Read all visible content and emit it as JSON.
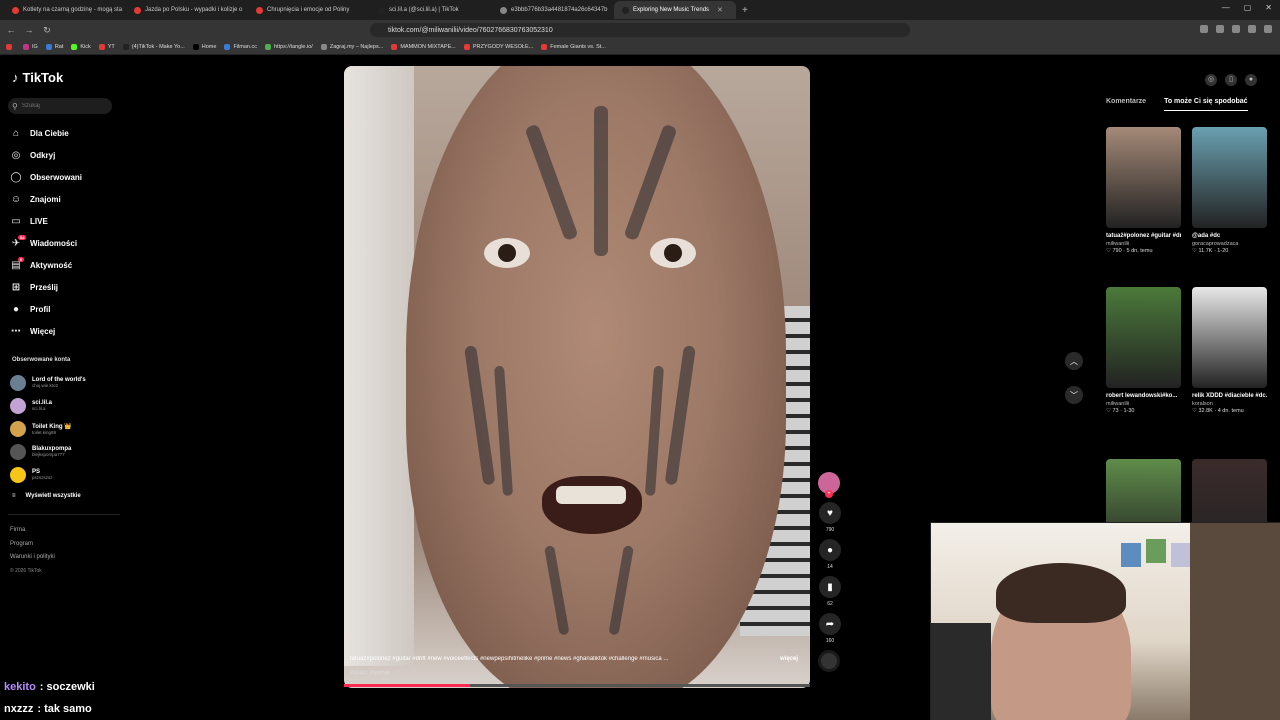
{
  "browser": {
    "tabs": [
      {
        "label": "Kotlety na czarną godzinę - mogą sta",
        "color": "#e53935",
        "active": false
      },
      {
        "label": "Jazda po Polsku - wypadki i kolizje o",
        "color": "#e53935",
        "active": false
      },
      {
        "label": "Chrupnięcia i emocje od Poliny",
        "color": "#e53935",
        "active": false
      },
      {
        "label": "sci.lil.a (@sci.lil.a) | TikTok",
        "color": "#222222",
        "active": false
      },
      {
        "label": "e3bbb776b33a4481874a26c64347b",
        "color": "#888888",
        "active": false
      },
      {
        "label": "Exploring New Music Trends",
        "color": "#222222",
        "active": true
      }
    ],
    "new_tab": "+",
    "url": "tiktok.com/@miliwanilii/video/7602766830763052310",
    "bookmarks": [
      {
        "label": "",
        "color": "#e53935"
      },
      {
        "label": "IG",
        "color": "#c13584"
      },
      {
        "label": "Rat",
        "color": "#3a7bd5"
      },
      {
        "label": "Kick",
        "color": "#53fc18"
      },
      {
        "label": "YT",
        "color": "#e53935"
      },
      {
        "label": "(4)TikTok - Make Yo...",
        "color": "#222222"
      },
      {
        "label": "Home",
        "color": "#000000"
      },
      {
        "label": "Filman.cc",
        "color": "#3a7bd5"
      },
      {
        "label": "https://tangle.io/",
        "color": "#4caf50"
      },
      {
        "label": "Zagraj.my – Najleps...",
        "color": "#888888"
      },
      {
        "label": "MAMMON MIXTAPE...",
        "color": "#e53935"
      },
      {
        "label": "PRZYGODY WESOŁE...",
        "color": "#e53935"
      },
      {
        "label": "Female Giants vs. St...",
        "color": "#e53935"
      }
    ]
  },
  "tiktok": {
    "logo": "TikTok",
    "search_placeholder": "Szukaj",
    "nav": [
      {
        "label": "Dla Ciebie",
        "icon": "home-icon",
        "glyph": "⌂",
        "badge": ""
      },
      {
        "label": "Odkryj",
        "icon": "compass-icon",
        "glyph": "◎",
        "badge": ""
      },
      {
        "label": "Obserwowani",
        "icon": "following-icon",
        "glyph": "◯",
        "badge": ""
      },
      {
        "label": "Znajomi",
        "icon": "friends-icon",
        "glyph": "☺",
        "badge": ""
      },
      {
        "label": "LIVE",
        "icon": "live-icon",
        "glyph": "▭",
        "badge": ""
      },
      {
        "label": "Wiadomości",
        "icon": "messages-icon",
        "glyph": "✈",
        "badge": "54"
      },
      {
        "label": "Aktywność",
        "icon": "activity-icon",
        "glyph": "▤",
        "badge": "9"
      },
      {
        "label": "Prześlij",
        "icon": "upload-icon",
        "glyph": "⊞",
        "badge": ""
      },
      {
        "label": "Profil",
        "icon": "profile-icon",
        "glyph": "●",
        "badge": ""
      },
      {
        "label": "Więcej",
        "icon": "more-icon",
        "glyph": "⋯",
        "badge": ""
      }
    ],
    "followed_title": "Obserwowane konta",
    "accounts": [
      {
        "name": "Lord of the world's",
        "handle": "chuj.wie.kto2",
        "color": "#6a7f92"
      },
      {
        "name": "sci.lil.a",
        "handle": "sci.lil.a",
        "color": "#c3a2d6"
      },
      {
        "name": "Toilet King 👑",
        "handle": "toilet.king69",
        "color": "#d4a24c"
      },
      {
        "name": "Blakuxpompa",
        "handle": "blejkspompa777",
        "color": "#555555"
      },
      {
        "name": "PS",
        "handle": "pszszszsz",
        "color": "#f5c518"
      }
    ],
    "show_all": "Wyświetl wszystkie",
    "footer": [
      "Firma",
      "Program",
      "Warunki i polityki"
    ],
    "copyright": "© 2026 TikTok"
  },
  "video": {
    "caption": "tatuaż#polonez #guitar #drift #new #voiceeffects #newpepsihitmelike #prime #news #ghanatiktok #challenge #musica ...",
    "more_label": "więcej",
    "original_label": "Zobacz oryginał",
    "progress": 0.27,
    "likes": "790",
    "comments": "14",
    "saves": "62",
    "shares": "160"
  },
  "right_panel": {
    "tabs": [
      "Komentarze",
      "To może Ci się spodobać"
    ],
    "active_tab": 1,
    "cards": [
      {
        "title": "tatuaż#polonez #guitar #drift...",
        "author": "miliwanilii",
        "stats": "♡ 790 · 5 dn. temu",
        "color": "#a58a78"
      },
      {
        "title": "@ada #dc",
        "author": "goracaprowadzaca",
        "stats": "♡ 11.7K · 1-20",
        "color": "#6aa0b0"
      },
      {
        "title": "robert lewandowski#ko...",
        "author": "miliwanilii",
        "stats": "♡ 73 · 1-30",
        "color": "#4b7a3a"
      },
      {
        "title": "relik XDDD #diacieble #dc...",
        "author": "koralson",
        "stats": "♡ 32.8K · 4 dn. temu",
        "color": "#e8e8e8"
      },
      {
        "title": "",
        "author": "",
        "stats": "",
        "color": "#5f8c4a"
      },
      {
        "title": "",
        "author": "",
        "stats": "",
        "color": "#3b2b2b"
      }
    ]
  },
  "chat": [
    {
      "user": "kekito",
      "message": ": soczewki"
    },
    {
      "user": "nxzzz",
      "message": ": tak samo"
    }
  ]
}
